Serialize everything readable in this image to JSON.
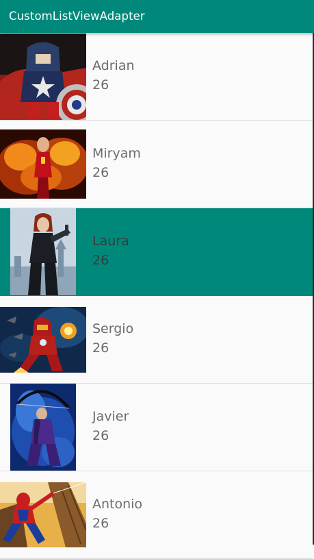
{
  "app_bar": {
    "title": "CustomListViewAdapter"
  },
  "colors": {
    "primary": "#00897b",
    "background": "#fafafa",
    "text": "#6b6b6b"
  },
  "list": {
    "items": [
      {
        "name": "Adrian",
        "age": "26",
        "image": "captain-america-image",
        "selected": false
      },
      {
        "name": "Miryam",
        "age": "26",
        "image": "phoenix-fire-image",
        "selected": false
      },
      {
        "name": "Laura",
        "age": "26",
        "image": "black-widow-image",
        "selected": true
      },
      {
        "name": "Sergio",
        "age": "26",
        "image": "iron-man-image",
        "selected": false
      },
      {
        "name": "Javier",
        "age": "26",
        "image": "hawkeye-image",
        "selected": false
      },
      {
        "name": "Antonio",
        "age": "26",
        "image": "spider-man-image",
        "selected": false
      }
    ]
  }
}
